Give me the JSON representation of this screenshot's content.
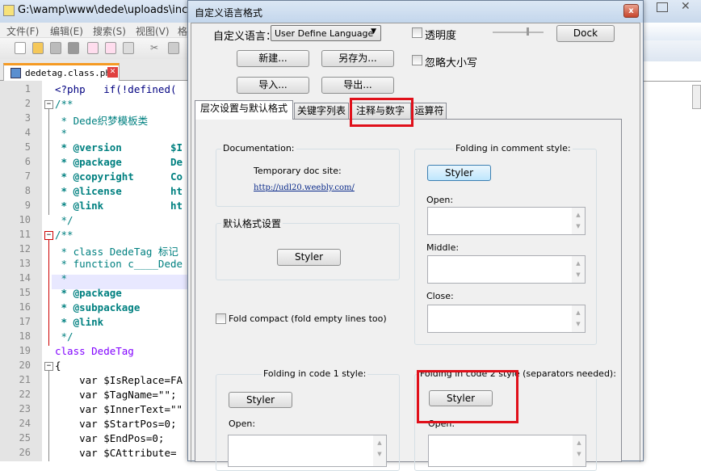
{
  "main_window": {
    "title": "G:\\wamp\\www\\dede\\uploads\\includ",
    "menu": [
      "文件(F)",
      "编辑(E)",
      "搜索(S)",
      "视图(V)",
      "格"
    ],
    "file_tab": "dedetag.class.php"
  },
  "editor": {
    "lines": [
      {
        "n": "1",
        "t": "<?php   if(!defined("
      },
      {
        "n": "2",
        "t": "/**"
      },
      {
        "n": "3",
        "t": " * Dede织梦模板类"
      },
      {
        "n": "4",
        "t": " *"
      },
      {
        "n": "5",
        "t": " * @version        $I"
      },
      {
        "n": "6",
        "t": " * @package        De"
      },
      {
        "n": "7",
        "t": " * @copyright      Co"
      },
      {
        "n": "8",
        "t": " * @license        ht"
      },
      {
        "n": "9",
        "t": " * @link           ht"
      },
      {
        "n": "10",
        "t": " */"
      },
      {
        "n": "11",
        "t": "/**"
      },
      {
        "n": "12",
        "t": " * class DedeTag 标记"
      },
      {
        "n": "13",
        "t": " * function c____Dede"
      },
      {
        "n": "14",
        "t": " *"
      },
      {
        "n": "15",
        "t": " * @package"
      },
      {
        "n": "16",
        "t": " * @subpackage"
      },
      {
        "n": "17",
        "t": " * @link"
      },
      {
        "n": "18",
        "t": " */"
      },
      {
        "n": "19",
        "t": "class DedeTag"
      },
      {
        "n": "20",
        "t": "{"
      },
      {
        "n": "21",
        "t": "    var $IsReplace=FA"
      },
      {
        "n": "22",
        "t": "    var $TagName=\"\";"
      },
      {
        "n": "23",
        "t": "    var $InnerText=\"\""
      },
      {
        "n": "24",
        "t": "    var $StartPos=0;"
      },
      {
        "n": "25",
        "t": "    var $EndPos=0;"
      },
      {
        "n": "26",
        "t": "    var $CAttribute="
      }
    ]
  },
  "dialog": {
    "title": "自定义语言格式",
    "close": "x",
    "lang_label": "自定义语言：",
    "lang_select": "User Define Language",
    "transparency": "透明度",
    "dock": "Dock",
    "new": "新建...",
    "save_as": "另存为...",
    "ignore_case": "忽略大小写",
    "import": "导入...",
    "export": "导出...",
    "tabs": [
      "层次设置与默认格式",
      "关键字列表",
      "注释与数字",
      "运算符"
    ],
    "doc": {
      "title": "Documentation:",
      "site_label": "Temporary doc site:",
      "link": "http://udl20.weebly.com/"
    },
    "default_style": {
      "title": "默认格式设置",
      "styler": "Styler"
    },
    "fold_compact": "Fold compact (fold empty lines too)",
    "comment_fold": {
      "title": "Folding in comment style:",
      "styler": "Styler",
      "open": "Open:",
      "middle": "Middle:",
      "close": "Close:"
    },
    "code1_fold": {
      "title": "Folding in code 1 style:",
      "styler": "Styler",
      "open": "Open:"
    },
    "code2_fold": {
      "title": "Folding in code 2 style (separators needed):",
      "styler": "Styler",
      "open": "Open:"
    }
  },
  "colors": {
    "highlight": "#e0101a",
    "fold_tab": "#f59a23"
  }
}
